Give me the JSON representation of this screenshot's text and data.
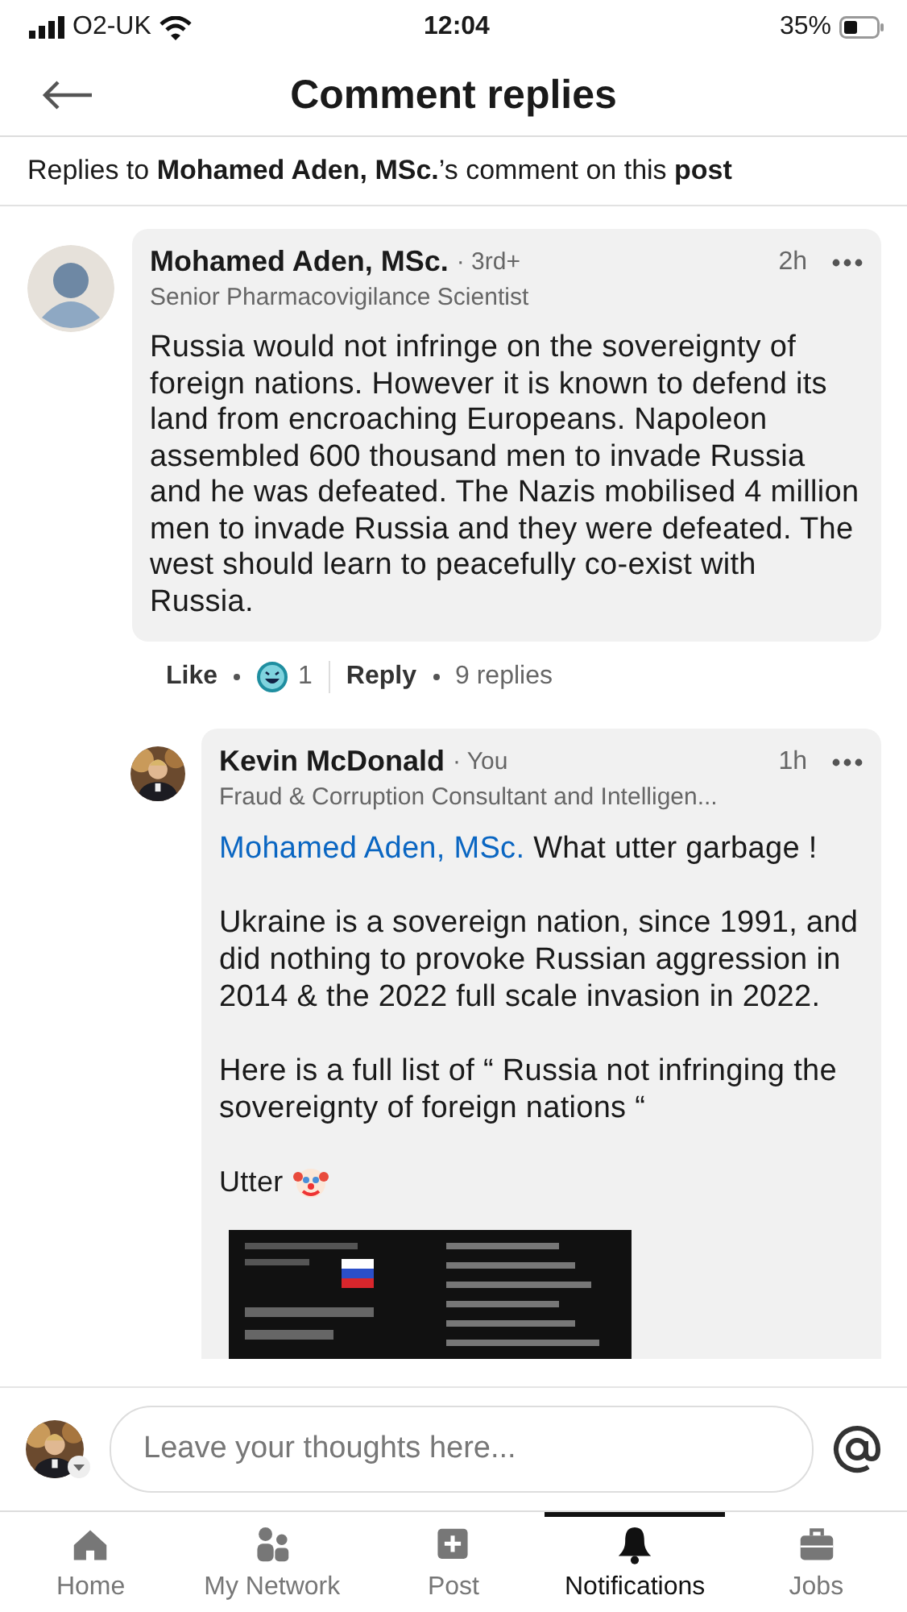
{
  "status_bar": {
    "carrier": "O2-UK",
    "time": "12:04",
    "battery": "35%"
  },
  "header": {
    "title": "Comment replies"
  },
  "context": {
    "text": "Replies to **Mohamed Aden, MSc.**’s comment on this **post**"
  },
  "comment": {
    "author": "Mohamed Aden, MSc.",
    "degree": "· 3rd+",
    "time": "2h",
    "headline": "Senior Pharmacovigilance Scientist",
    "body": "Russia would not infringe on the sovereignty of foreign nations. However it is known to defend its land from encroaching Europeans. Napoleon assembled 600 thousand men to invade Russia and he was defeated. The Nazis mobilised 4 million men to invade Russia and they were defeated. The west should learn to peacefully co-exist with Russia.",
    "actions": {
      "like": "Like",
      "reaction_count": "1",
      "reply": "Reply",
      "replies": "9 replies"
    }
  },
  "reply": {
    "author": "Kevin McDonald",
    "degree": "· You",
    "time": "1h",
    "headline": "Fraud & Corruption Consultant and Intelligen...",
    "paragraphs": [
      {
        "mention": "Mohamed Aden, MSc.",
        "text": "What utter garbage !",
        "trailing_icon": false
      },
      {
        "text": "Ukraine is a sovereign nation, since 1991, and did nothing to provoke Russian aggression in 2014 & the 2022 full scale invasion in 2022.",
        "trailing_icon": false
      },
      {
        "text": "Here is a full list of “ Russia not infringing the sovereignty of foreign nations “",
        "trailing_icon": false
      },
      {
        "text": "Utter",
        "trailing_icon": true
      }
    ]
  },
  "composer": {
    "placeholder": "Leave your thoughts here..."
  },
  "nav": [
    {
      "label": "Home",
      "selected": false
    },
    {
      "label": "My Network",
      "selected": false
    },
    {
      "label": "Post",
      "selected": false
    },
    {
      "label": "Notifications",
      "selected": true
    },
    {
      "label": "Jobs",
      "selected": false
    }
  ]
}
